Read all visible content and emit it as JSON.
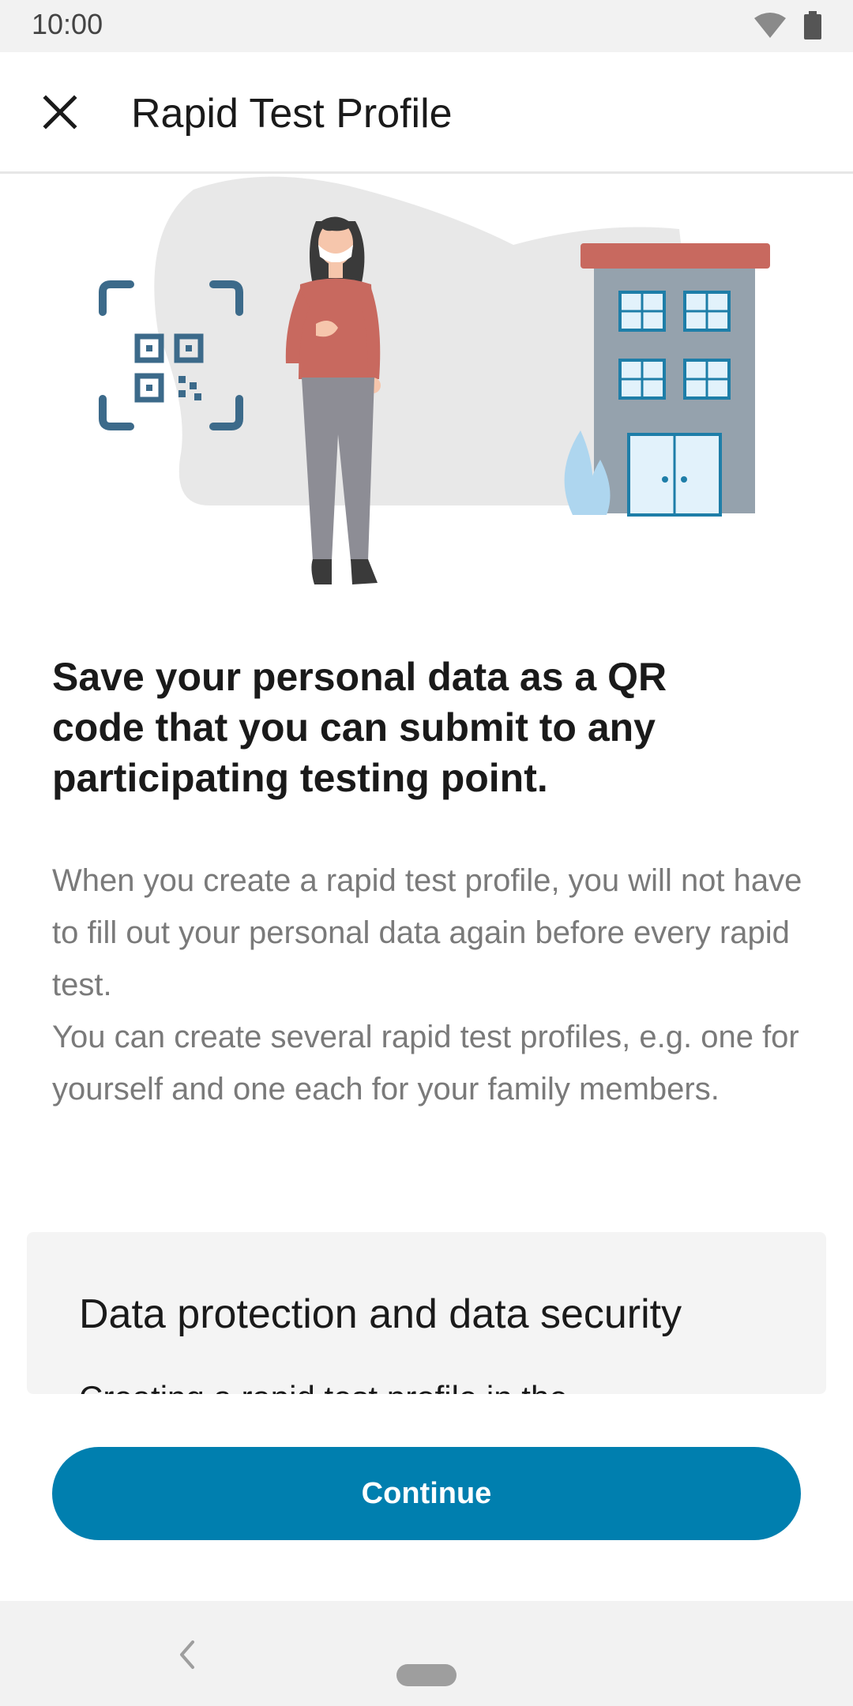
{
  "status_bar": {
    "time": "10:00"
  },
  "app_bar": {
    "title": "Rapid Test Profile"
  },
  "content": {
    "headline": "Save your personal data as a QR code that you can submit to any participating testing point.",
    "paragraph_1": "When you create a rapid test profile, you will not have to fill out your personal data again before every rapid test.",
    "paragraph_2": "You can create several rapid test profiles, e.g. one for yourself and one each for your family members."
  },
  "info_card": {
    "title": "Data protection and data security",
    "peek_text": "Creating a rapid test profile in the"
  },
  "footer": {
    "continue_label": "Continue"
  },
  "colors": {
    "accent": "#007faf",
    "illustration_blue": "#3c6a8a",
    "roof": "#c8695f",
    "building": "#95a2ad"
  }
}
